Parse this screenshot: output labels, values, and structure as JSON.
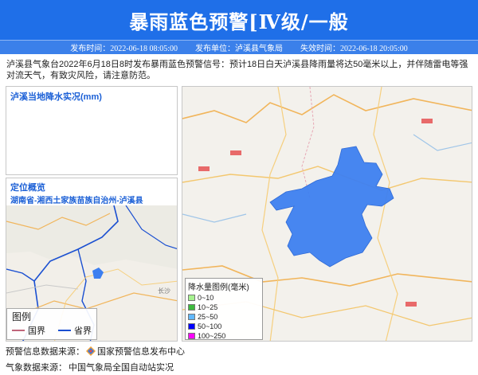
{
  "header": {
    "title": "暴雨蓝色预警[Ⅳ级/一般",
    "publish_time": "发布时间：2022-06-18 08:05:00",
    "publisher": "发布单位：泸溪县气象局",
    "expire_time": "失效时间：2022-06-18 20:05:00"
  },
  "description": "泸溪县气象台2022年6月18日8时发布暴雨蓝色预警信号：预计18日白天泸溪县降雨量将达50毫米以上，并伴随雷电等强对流天气，有致灾风险，请注意防范。",
  "rain_panel": {
    "title": "泸溪当地降水实况(mm)"
  },
  "location_panel": {
    "title": "定位概览",
    "subtitle": "湖南省-湘西土家族苗族自治州-泸溪县",
    "legend_title": "图例",
    "legend_items": [
      {
        "label": "国界",
        "color": "#c0657a"
      },
      {
        "label": "省界",
        "color": "#1a4fd1"
      }
    ]
  },
  "rain_legend": {
    "title": "降水量图例(毫米)",
    "items": [
      {
        "label": "0~10",
        "color": "#a6f28f"
      },
      {
        "label": "10~25",
        "color": "#3dba3d"
      },
      {
        "label": "25~50",
        "color": "#61b8ff"
      },
      {
        "label": "50~100",
        "color": "#0000fe"
      },
      {
        "label": "100~250",
        "color": "#fa00fa"
      }
    ]
  },
  "warning_area_color": "#3d7ff0",
  "footer": {
    "source_warning_label": "预警信息数据来源：",
    "source_warning_value": "国家预警信息发布中心",
    "source_weather_label": "气象数据来源：",
    "source_weather_value": "中国气象局全国自动站实况"
  }
}
